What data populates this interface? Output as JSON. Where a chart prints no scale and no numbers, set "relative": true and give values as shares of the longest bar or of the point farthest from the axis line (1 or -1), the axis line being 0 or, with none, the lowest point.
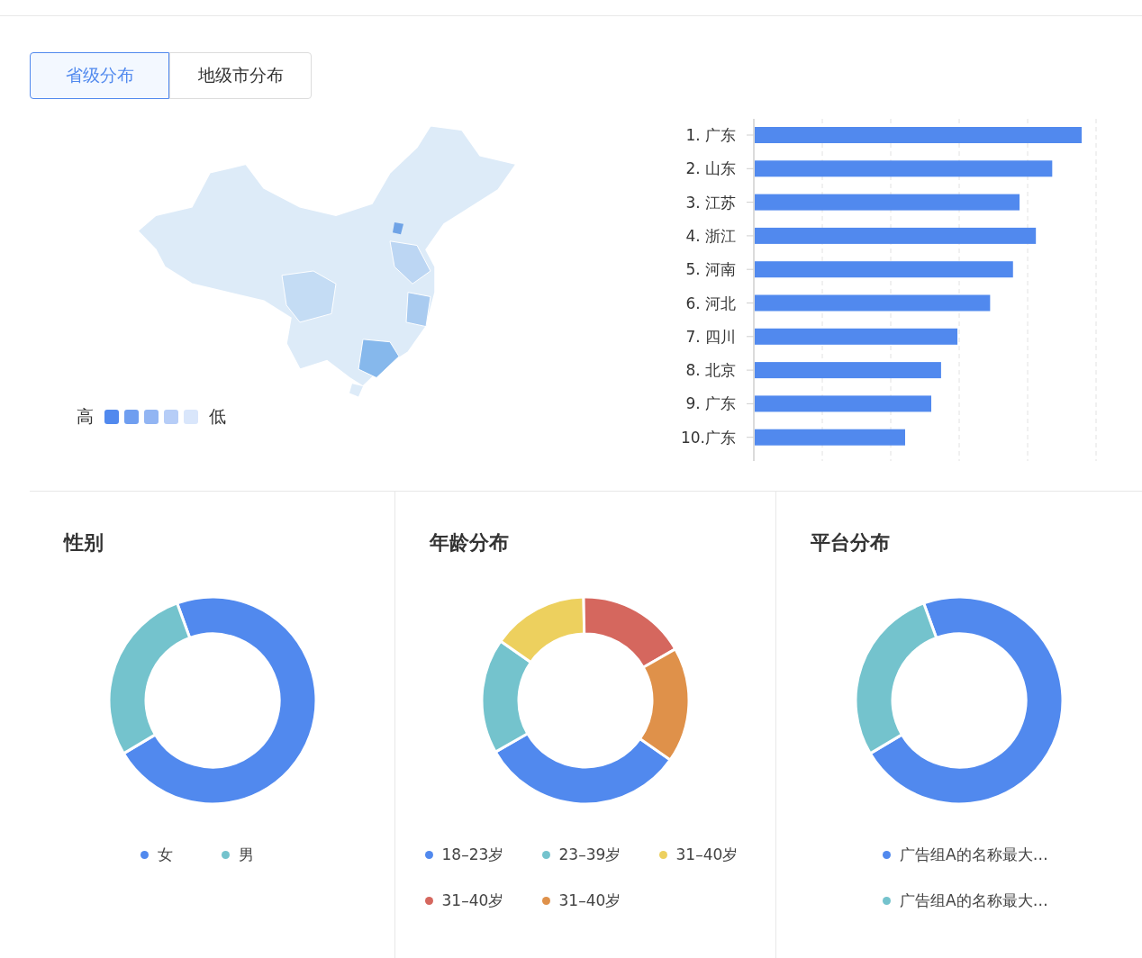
{
  "tabs": [
    {
      "label": "省级分布",
      "selected": true
    },
    {
      "label": "地级市分布",
      "selected": false
    }
  ],
  "map_legend": {
    "high_label": "高",
    "low_label": "低",
    "swatches": [
      {
        "color": "#5189ee"
      },
      {
        "color": "#6f9ef0"
      },
      {
        "color": "#92b5f3"
      },
      {
        "color": "#b6cdf7"
      },
      {
        "color": "#d9e6fb"
      }
    ]
  },
  "ranking": {
    "chart_data": {
      "type": "bar",
      "orientation": "horizontal",
      "categories": [
        "1. 广东",
        "2. 山东",
        "3. 江苏",
        "4. 浙江",
        "5. 河南",
        "6. 河北",
        "7. 四川",
        "8. 北京",
        "9. 广东",
        "10.广东"
      ],
      "relative": true,
      "series": [
        {
          "color": "#5189ee",
          "values": [
            1,
            0.91,
            0.81,
            0.86,
            0.79,
            0.72,
            0.62,
            0.57,
            0.54,
            0.46
          ]
        }
      ]
    }
  },
  "panels": [
    {
      "title": "性别",
      "chart_data": {
        "type": "donut",
        "categories": [
          "女",
          "男"
        ],
        "series": [
          {
            "values": [
              72,
              28
            ]
          }
        ],
        "colors": [
          "#5189ee",
          "#74c3cd"
        ]
      }
    },
    {
      "title": "年龄分布",
      "chart_data": {
        "type": "donut",
        "categories": [
          "18–23岁",
          "23–39岁",
          "31–40岁",
          "31–40岁",
          "31–40岁"
        ],
        "series": [
          {
            "values": [
              32,
              18,
              15,
              17,
              18
            ]
          }
        ],
        "colors": [
          "#5189ee",
          "#74c3cd",
          "#edd05e",
          "#d5675e",
          "#df914a"
        ]
      }
    },
    {
      "title": "平台分布",
      "chart_data": {
        "type": "donut",
        "categories": [
          "广告组A的名称最大…",
          "广告组A的名称最大…"
        ],
        "series": [
          {
            "values": [
              72,
              28
            ]
          }
        ],
        "colors": [
          "#5189ee",
          "#74c3cd"
        ]
      }
    }
  ]
}
